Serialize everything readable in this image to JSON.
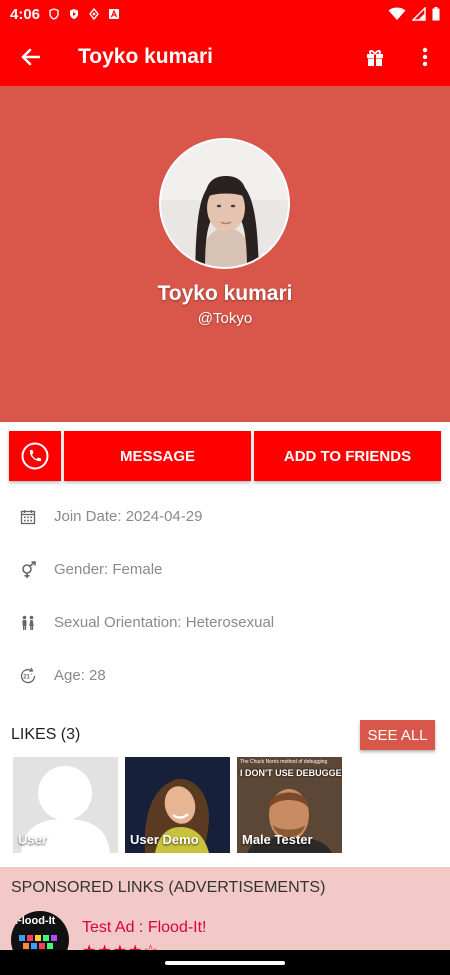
{
  "status_bar": {
    "time": "4:06"
  },
  "app_bar": {
    "title": "Toyko kumari"
  },
  "profile": {
    "name": "Toyko kumari",
    "handle": "@Tokyo"
  },
  "actions": {
    "message_label": "MESSAGE",
    "add_friends_label": "ADD TO FRIENDS"
  },
  "info": [
    {
      "icon": "calendar-icon",
      "text": "Join Date: 2024-04-29"
    },
    {
      "icon": "gender-icon",
      "text": "Gender: Female"
    },
    {
      "icon": "couple-icon",
      "text": "Sexual Orientation: Heterosexual"
    },
    {
      "icon": "age-21-icon",
      "text": "Age: 28"
    }
  ],
  "likes": {
    "title": "LIKES (3)",
    "see_all_label": "SEE ALL",
    "items": [
      {
        "label": "User"
      },
      {
        "label": "User Demo"
      },
      {
        "label": "Male Tester"
      }
    ],
    "meme_caption_top": "The Chuck Norris method of debugging",
    "meme_caption_main": "I DON'T USE DEBUGGERS"
  },
  "sponsored": {
    "title": "SPONSORED LINKS (ADVERTISEMENTS)",
    "ad_title": "Test Ad : Flood-It!",
    "ad_logo_text": "Flood-It",
    "ad_stars": "★★★★☆"
  },
  "colors": {
    "primary": "#ff0000",
    "header_bg": "#d9574a",
    "sponsored_bg": "#f2c9c6",
    "ad_text": "#d9003a"
  }
}
